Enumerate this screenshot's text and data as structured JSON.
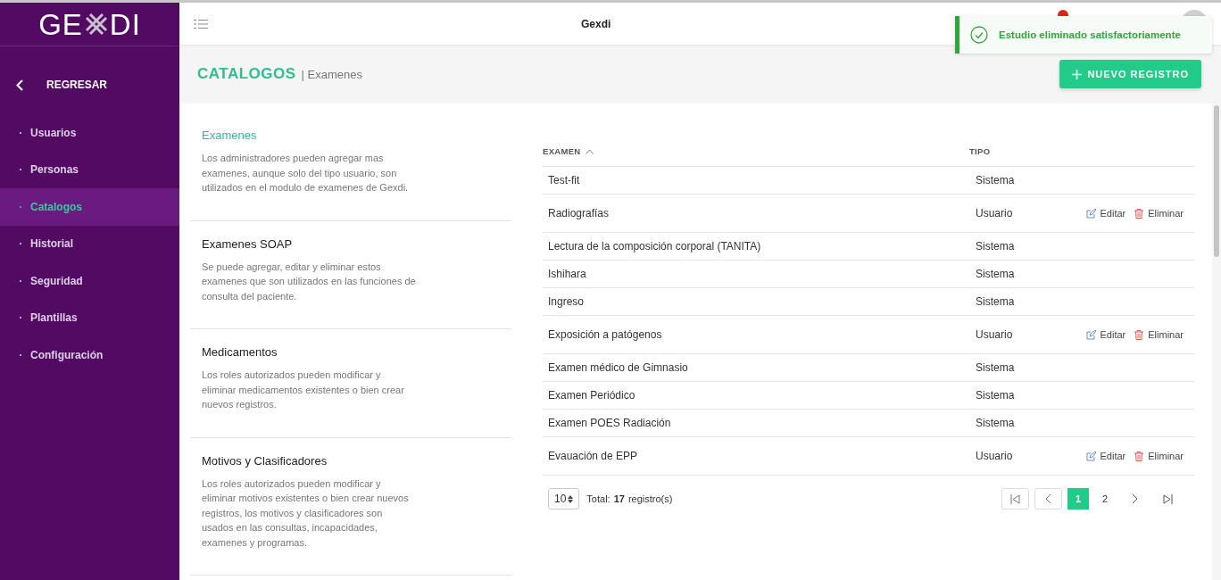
{
  "logo": {
    "left": "GE",
    "right": "DI"
  },
  "sidebar": {
    "back": "REGRESAR",
    "items": [
      {
        "label": "Usuarios",
        "selected": false
      },
      {
        "label": "Personas",
        "selected": false
      },
      {
        "label": "Catalogos",
        "selected": true
      },
      {
        "label": "Historial",
        "selected": false
      },
      {
        "label": "Seguridad",
        "selected": false
      },
      {
        "label": "Plantillas",
        "selected": false
      },
      {
        "label": "Configuración",
        "selected": false
      }
    ]
  },
  "header": {
    "title": "Gexdi"
  },
  "toast": {
    "message": "Estudio eliminado satisfactoriamente"
  },
  "page": {
    "title": "CATALOGOS",
    "breadcrumb": "| Examenes",
    "new_button": "NUEVO REGISTRO"
  },
  "catalogs": [
    {
      "title": "Examenes",
      "selected": true,
      "description": "Los administradores pueden agregar mas examenes, aunque solo del tipo usuario, son utilizados en el modulo de examenes de Gexdi."
    },
    {
      "title": "Examenes SOAP",
      "selected": false,
      "description": "Se puede agregar, editar y eliminar estos examenes que son utilizados en las funciones de consulta del paciente."
    },
    {
      "title": "Medicamentos",
      "selected": false,
      "description": "Los roles autorizados pueden modificar y eliminar medicamentos existentes o bien crear nuevos registros."
    },
    {
      "title": "Motivos y Clasificadores",
      "selected": false,
      "description": "Los roles autorizados pueden modificar y eliminar motivos existentes o bien crear nuevos registros, los motivos y clasificadores son usados en las consultas, incapacidades, examenes y programas."
    }
  ],
  "table": {
    "columns": [
      "EXAMEN",
      "TIPO"
    ],
    "rows": [
      {
        "examen": "Test-fit",
        "tipo": "Sistema"
      },
      {
        "examen": "Radiografías",
        "tipo": "Usuario",
        "actions": [
          "Editar",
          "Eliminar"
        ]
      },
      {
        "examen": "Lectura de la composición corporal (TANITA)",
        "tipo": "Sistema"
      },
      {
        "examen": "Ishihara",
        "tipo": "Sistema"
      },
      {
        "examen": "Ingreso",
        "tipo": "Sistema"
      },
      {
        "examen": "Exposición a patógenos",
        "tipo": "Usuario",
        "actions": [
          "Editar",
          "Eliminar"
        ]
      },
      {
        "examen": "Examen médico de Gimnasio",
        "tipo": "Sistema"
      },
      {
        "examen": "Examen Periódico",
        "tipo": "Sistema"
      },
      {
        "examen": "Examen POES Radiación",
        "tipo": "Sistema"
      },
      {
        "examen": "Evauación de EPP",
        "tipo": "Usuario",
        "actions": [
          "Editar",
          "Eliminar"
        ]
      }
    ]
  },
  "pagination": {
    "page_size": "10",
    "total_label": "Total:",
    "total": "17",
    "total_unit": "registro(s)",
    "pages": [
      {
        "label": "1",
        "selected": true
      },
      {
        "label": "2",
        "selected": false
      }
    ]
  }
}
